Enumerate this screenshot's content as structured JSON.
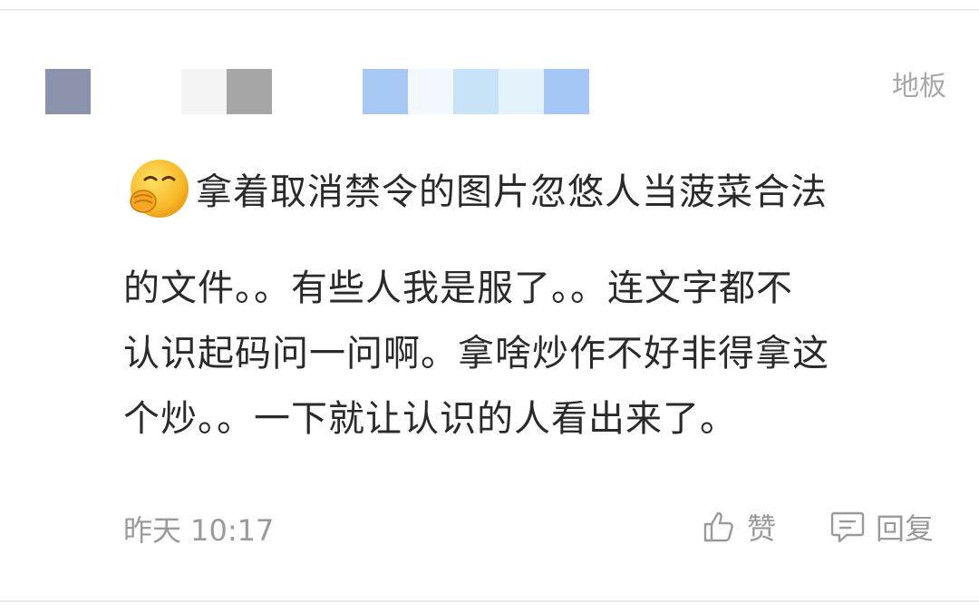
{
  "header": {
    "floor_label": "地板",
    "username_pixels": [
      {
        "color": "#8c93ad"
      },
      {
        "color": "#ffffff"
      },
      {
        "color": "#f4f4f4"
      },
      {
        "color": "#a6a6a6"
      },
      {
        "color": "#ffffff"
      },
      {
        "color": "#ffffff"
      },
      {
        "color": "#a8c8f4"
      },
      {
        "color": "#f2f8fd"
      },
      {
        "color": "#c8e2f7"
      },
      {
        "color": "#e4f2fc"
      },
      {
        "color": "#a6c7f5"
      }
    ]
  },
  "comment": {
    "emoji": "snicker-face-emoji",
    "lines": [
      "拿着取消禁令的图片忽悠人当菠菜合法",
      "的文件。。有些人我是服了。。连文字都不",
      "认识起码问一问啊。拿啥炒作不好非得拿这",
      "个炒。。一下就让认识的人看出来了。"
    ]
  },
  "footer": {
    "timestamp": "昨天 10:17",
    "like_label": "赞",
    "reply_label": "回复",
    "like_icon": "thumbs-up-icon",
    "reply_icon": "comment-icon"
  }
}
